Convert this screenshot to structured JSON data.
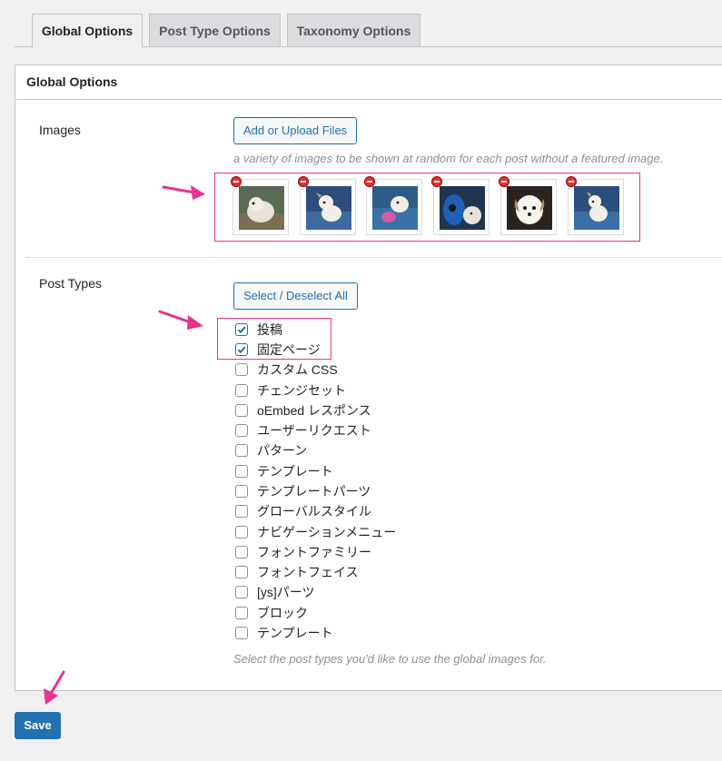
{
  "tabs": [
    {
      "label": "Global Options"
    },
    {
      "label": "Post Type Options"
    },
    {
      "label": "Taxonomy Options"
    }
  ],
  "panel": {
    "title": "Global Options"
  },
  "images_section": {
    "label": "Images",
    "button_label": "Add or Upload Files",
    "description": "a variety of images to be shown at random for each post without a featured image.",
    "thumbnail_count": 6
  },
  "post_types_section": {
    "label": "Post Types",
    "button_label": "Select / Deselect All",
    "description": "Select the post types you'd like to use the global images for.",
    "items": [
      {
        "label": "投稿",
        "checked": true
      },
      {
        "label": "固定ページ",
        "checked": true
      },
      {
        "label": "カスタム CSS",
        "checked": false
      },
      {
        "label": "チェンジセット",
        "checked": false
      },
      {
        "label": "oEmbed レスポンス",
        "checked": false
      },
      {
        "label": "ユーザーリクエスト",
        "checked": false
      },
      {
        "label": "パターン",
        "checked": false
      },
      {
        "label": "テンプレート",
        "checked": false
      },
      {
        "label": "テンプレートパーツ",
        "checked": false
      },
      {
        "label": "グローバルスタイル",
        "checked": false
      },
      {
        "label": "ナビゲーションメニュー",
        "checked": false
      },
      {
        "label": "フォントファミリー",
        "checked": false
      },
      {
        "label": "フォントフェイス",
        "checked": false
      },
      {
        "label": "[ys]パーツ",
        "checked": false
      },
      {
        "label": "ブロック",
        "checked": false
      },
      {
        "label": "テンプレート",
        "checked": false
      }
    ]
  },
  "save_label": "Save",
  "colors": {
    "accent": "#2271b1",
    "highlight": "#e8338c",
    "remove": "#d63638",
    "background": "#f0f0f1"
  }
}
